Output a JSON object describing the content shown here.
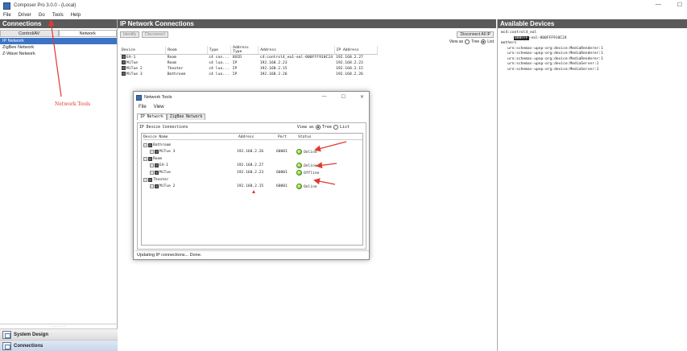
{
  "window": {
    "title": "Composer Pro 3.0.0 - (Local)",
    "controls": [
      "—",
      "☐"
    ]
  },
  "menu": [
    "File",
    "Driver",
    "Go",
    "Tools",
    "Help"
  ],
  "left_panel": {
    "title": "Connections",
    "tabs": [
      "Control/AV",
      "Network"
    ],
    "active_tab": 1,
    "items": [
      "IP Network",
      "ZigBee Network",
      "Z-Wave Network"
    ],
    "selected_item": 0,
    "grip": "·······",
    "nav": [
      {
        "label": "System Design"
      },
      {
        "label": "Connections"
      }
    ]
  },
  "center_panel": {
    "title": "IP Network Connections",
    "identify_label": "Identify",
    "disconnect_label": "Disconnect",
    "disconnect_all_label": "Disconnect All IP",
    "view_as_label": "View as",
    "view_options": [
      "Tree",
      "List"
    ],
    "view_selected": 1,
    "columns": [
      "Device",
      "Room",
      "Type",
      "Address Type",
      "Address",
      "IP Address"
    ],
    "rows": [
      [
        "EA-1",
        "Room",
        "c4 con...",
        "UUID",
        "c4:control4_ea1-eal-000FFF910C24",
        "192.168.2.27"
      ],
      [
        "MiTue",
        "Room",
        "c4 lua...",
        "IP",
        "192.168.2.23",
        "192.168.2.23"
      ],
      [
        "MiTue 2",
        "Theater",
        "c4 lua...",
        "IP",
        "192.168.2.15",
        "192.168.2.15"
      ],
      [
        "MiTue 3",
        "Bathroom",
        "c4 lua...",
        "IP",
        "192.168.2.26",
        "192.168.2.26"
      ]
    ]
  },
  "right_panel": {
    "title": "Available Devices",
    "tree": [
      {
        "text": "c4:control4_eal",
        "indent": 0,
        "prefix": "⊟"
      },
      {
        "text": "000FFF",
        "indent": 2,
        "prefix": "",
        "highlight": true,
        "suffix": "-eal-000FFF910C24"
      },
      {
        "text": "others",
        "indent": 0,
        "prefix": "⊟"
      },
      {
        "text": "urn:schemas-upnp-org:device:MediaRenderer:1",
        "indent": 1,
        "prefix": ""
      },
      {
        "text": "urn:schemas-upnp-org:device:MediaRenderer:1",
        "indent": 1,
        "prefix": ""
      },
      {
        "text": "urn:schemas-upnp-org:device:MediaRenderer:1",
        "indent": 1,
        "prefix": ""
      },
      {
        "text": "urn:schemas-upnp-org:device:MediaServer:1",
        "indent": 1,
        "prefix": ""
      },
      {
        "text": "urn:schemas-upnp-org:device:MediaServer:1",
        "indent": 1,
        "prefix": ""
      }
    ]
  },
  "tools_window": {
    "title": "Network Tools",
    "controls": [
      "—",
      "☐",
      "✕"
    ],
    "menu": [
      "File",
      "View"
    ],
    "tabs": [
      "IP Network",
      "ZigBee Network"
    ],
    "active_tab": 0,
    "section_label": "IP Device Connections",
    "view_as_label": "View as",
    "view_options": [
      "Tree",
      "List"
    ],
    "view_selected": 0,
    "columns": [
      "Device Name",
      "Address",
      "Port",
      "Status"
    ],
    "tree": [
      {
        "kind": "room",
        "name": "Bathroom",
        "indent": 0
      },
      {
        "kind": "device",
        "name": "MiTue 3",
        "indent": 2,
        "address": "192.168.2.26",
        "port": "60001",
        "status": "Online"
      },
      {
        "kind": "room",
        "name": "Room",
        "indent": 0
      },
      {
        "kind": "device",
        "name": "EA-1",
        "indent": 2,
        "address": "192.168.2.27",
        "port": "",
        "status": "Online"
      },
      {
        "kind": "device",
        "name": "MiTue",
        "indent": 2,
        "address": "192.168.2.23",
        "port": "60001",
        "status": "Offline"
      },
      {
        "kind": "room",
        "name": "Theater",
        "indent": 0
      },
      {
        "kind": "device",
        "name": "MiTue 2",
        "indent": 2,
        "address": "192.168.2.15",
        "port": "60001",
        "status": "Online"
      }
    ],
    "status_bar": "Updating IP connections... Done."
  },
  "annotation": {
    "label": "Network Tools",
    "color": "#e03a30"
  }
}
